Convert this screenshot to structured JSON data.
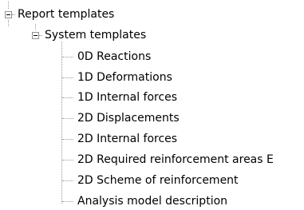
{
  "tree": {
    "root": {
      "label": "Report templates",
      "expanded": true,
      "children": [
        {
          "label": "System templates",
          "expanded": true,
          "children": [
            {
              "label": "0D Reactions"
            },
            {
              "label": "1D Deformations"
            },
            {
              "label": "1D Internal forces"
            },
            {
              "label": "2D Displacements"
            },
            {
              "label": "2D Internal forces"
            },
            {
              "label": "2D Required reinforcement areas E"
            },
            {
              "label": "2D Scheme of reinforcement"
            },
            {
              "label": "Analysis model description"
            }
          ]
        }
      ]
    }
  }
}
